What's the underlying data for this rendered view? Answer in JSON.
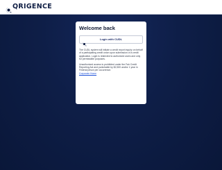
{
  "header": {
    "logo_text": "QRIGENCE",
    "logo_icon": "q-mark-icon",
    "background_color": "#ffffff",
    "brand_color": "#0e1d43"
  },
  "page": {
    "background_color": "#0e1d43"
  },
  "card": {
    "title": "Welcome back",
    "login_button": {
      "label": "Login with CUDL",
      "icon": "q-mark-icon"
    },
    "paragraph_1": "The CUDL system will initiate a credit report inquiry on behalf of a participating credit union upon submission of a credit application. Login is restricted to authorized users and only for permissible purposes.",
    "paragraph_2": "Unauthorized access is prohibited under the Fair Credit Reporting Act and punishable by $2,500 and/or 1 year in Federal prison per occurrence.",
    "link_label": "Corporate Home",
    "link_color": "#1b4fd8"
  }
}
